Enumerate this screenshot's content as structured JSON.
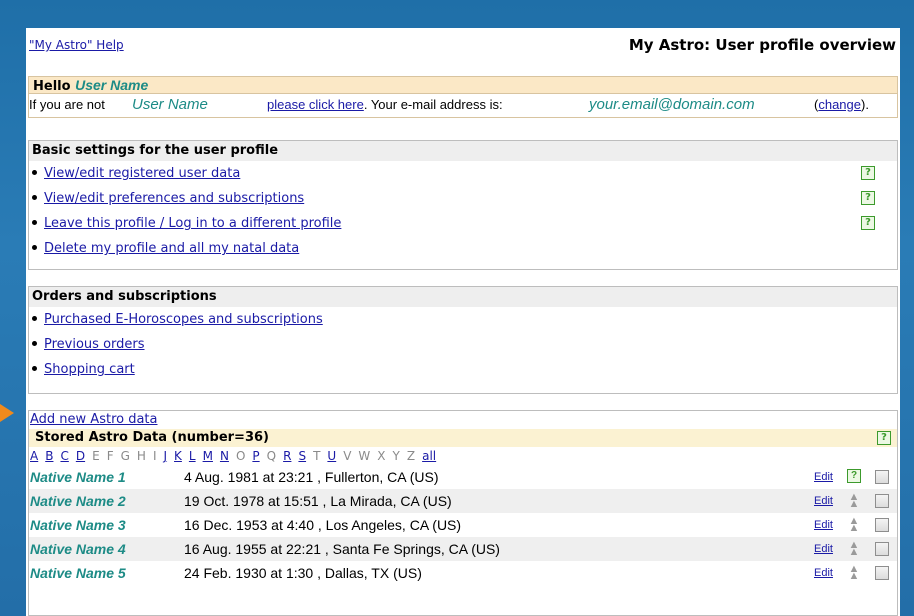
{
  "header": {
    "help_link": "\"My Astro\" Help",
    "title": "My Astro: User profile overview"
  },
  "hello": {
    "greeting": "Hello",
    "user_name": "User Name",
    "not_prefix": "If you are not",
    "click_here": "please click here",
    "email_text": ". Your e-mail address is:",
    "email": "your.email@domain.com",
    "change_open": "(",
    "change_label": "change",
    "change_close": ")."
  },
  "basic": {
    "heading": "Basic settings for the user profile",
    "items": [
      {
        "label": "View/edit registered user data",
        "help": "?"
      },
      {
        "label": "View/edit preferences and subscriptions",
        "help": "?"
      },
      {
        "label": "Leave this profile / Log in to a different profile",
        "help": "?"
      },
      {
        "label": "Delete my profile and all my natal data"
      }
    ]
  },
  "orders": {
    "heading": "Orders and subscriptions",
    "items": [
      {
        "label": "Purchased E-Horoscopes and subscriptions"
      },
      {
        "label": "Previous orders"
      },
      {
        "label": "Shopping cart"
      }
    ]
  },
  "astro": {
    "add_link": "Add new Astro data",
    "heading": "Stored Astro Data (number=36)",
    "help": "?",
    "letters": [
      {
        "l": "A",
        "link": true
      },
      {
        "l": "B",
        "link": true
      },
      {
        "l": "C",
        "link": true
      },
      {
        "l": "D",
        "link": true
      },
      {
        "l": "E",
        "link": false
      },
      {
        "l": "F",
        "link": false
      },
      {
        "l": "G",
        "link": false
      },
      {
        "l": "H",
        "link": false
      },
      {
        "l": "I",
        "link": false
      },
      {
        "l": "J",
        "link": true
      },
      {
        "l": "K",
        "link": true
      },
      {
        "l": "L",
        "link": true
      },
      {
        "l": "M",
        "link": true
      },
      {
        "l": "N",
        "link": true
      },
      {
        "l": "O",
        "link": false
      },
      {
        "l": "P",
        "link": true
      },
      {
        "l": "Q",
        "link": false
      },
      {
        "l": "R",
        "link": true
      },
      {
        "l": "S",
        "link": true
      },
      {
        "l": "T",
        "link": false
      },
      {
        "l": "U",
        "link": true
      },
      {
        "l": "V",
        "link": false
      },
      {
        "l": "W",
        "link": false
      },
      {
        "l": "X",
        "link": false
      },
      {
        "l": "Y",
        "link": false
      },
      {
        "l": "Z",
        "link": false
      },
      {
        "l": "all",
        "link": true
      }
    ],
    "rows": [
      {
        "name": "Native Name 1",
        "details": "4 Aug. 1981 at 23:21 , Fullerton, CA (US)",
        "edit": "Edit",
        "marker": "?"
      },
      {
        "name": "Native Name 2",
        "details": "19 Oct. 1978 at 15:51 , La Mirada, CA (US)",
        "edit": "Edit",
        "marker": "up"
      },
      {
        "name": "Native Name 3",
        "details": "16 Dec. 1953 at 4:40 , Los Angeles, CA (US)",
        "edit": "Edit",
        "marker": "up"
      },
      {
        "name": "Native Name 4",
        "details": "16 Aug. 1955 at 22:21 , Santa Fe Springs, CA (US)",
        "edit": "Edit",
        "marker": "up"
      },
      {
        "name": "Native Name 5",
        "details": "24 Feb. 1930 at 1:30 , Dallas, TX (US)",
        "edit": "Edit",
        "marker": "up"
      }
    ]
  }
}
